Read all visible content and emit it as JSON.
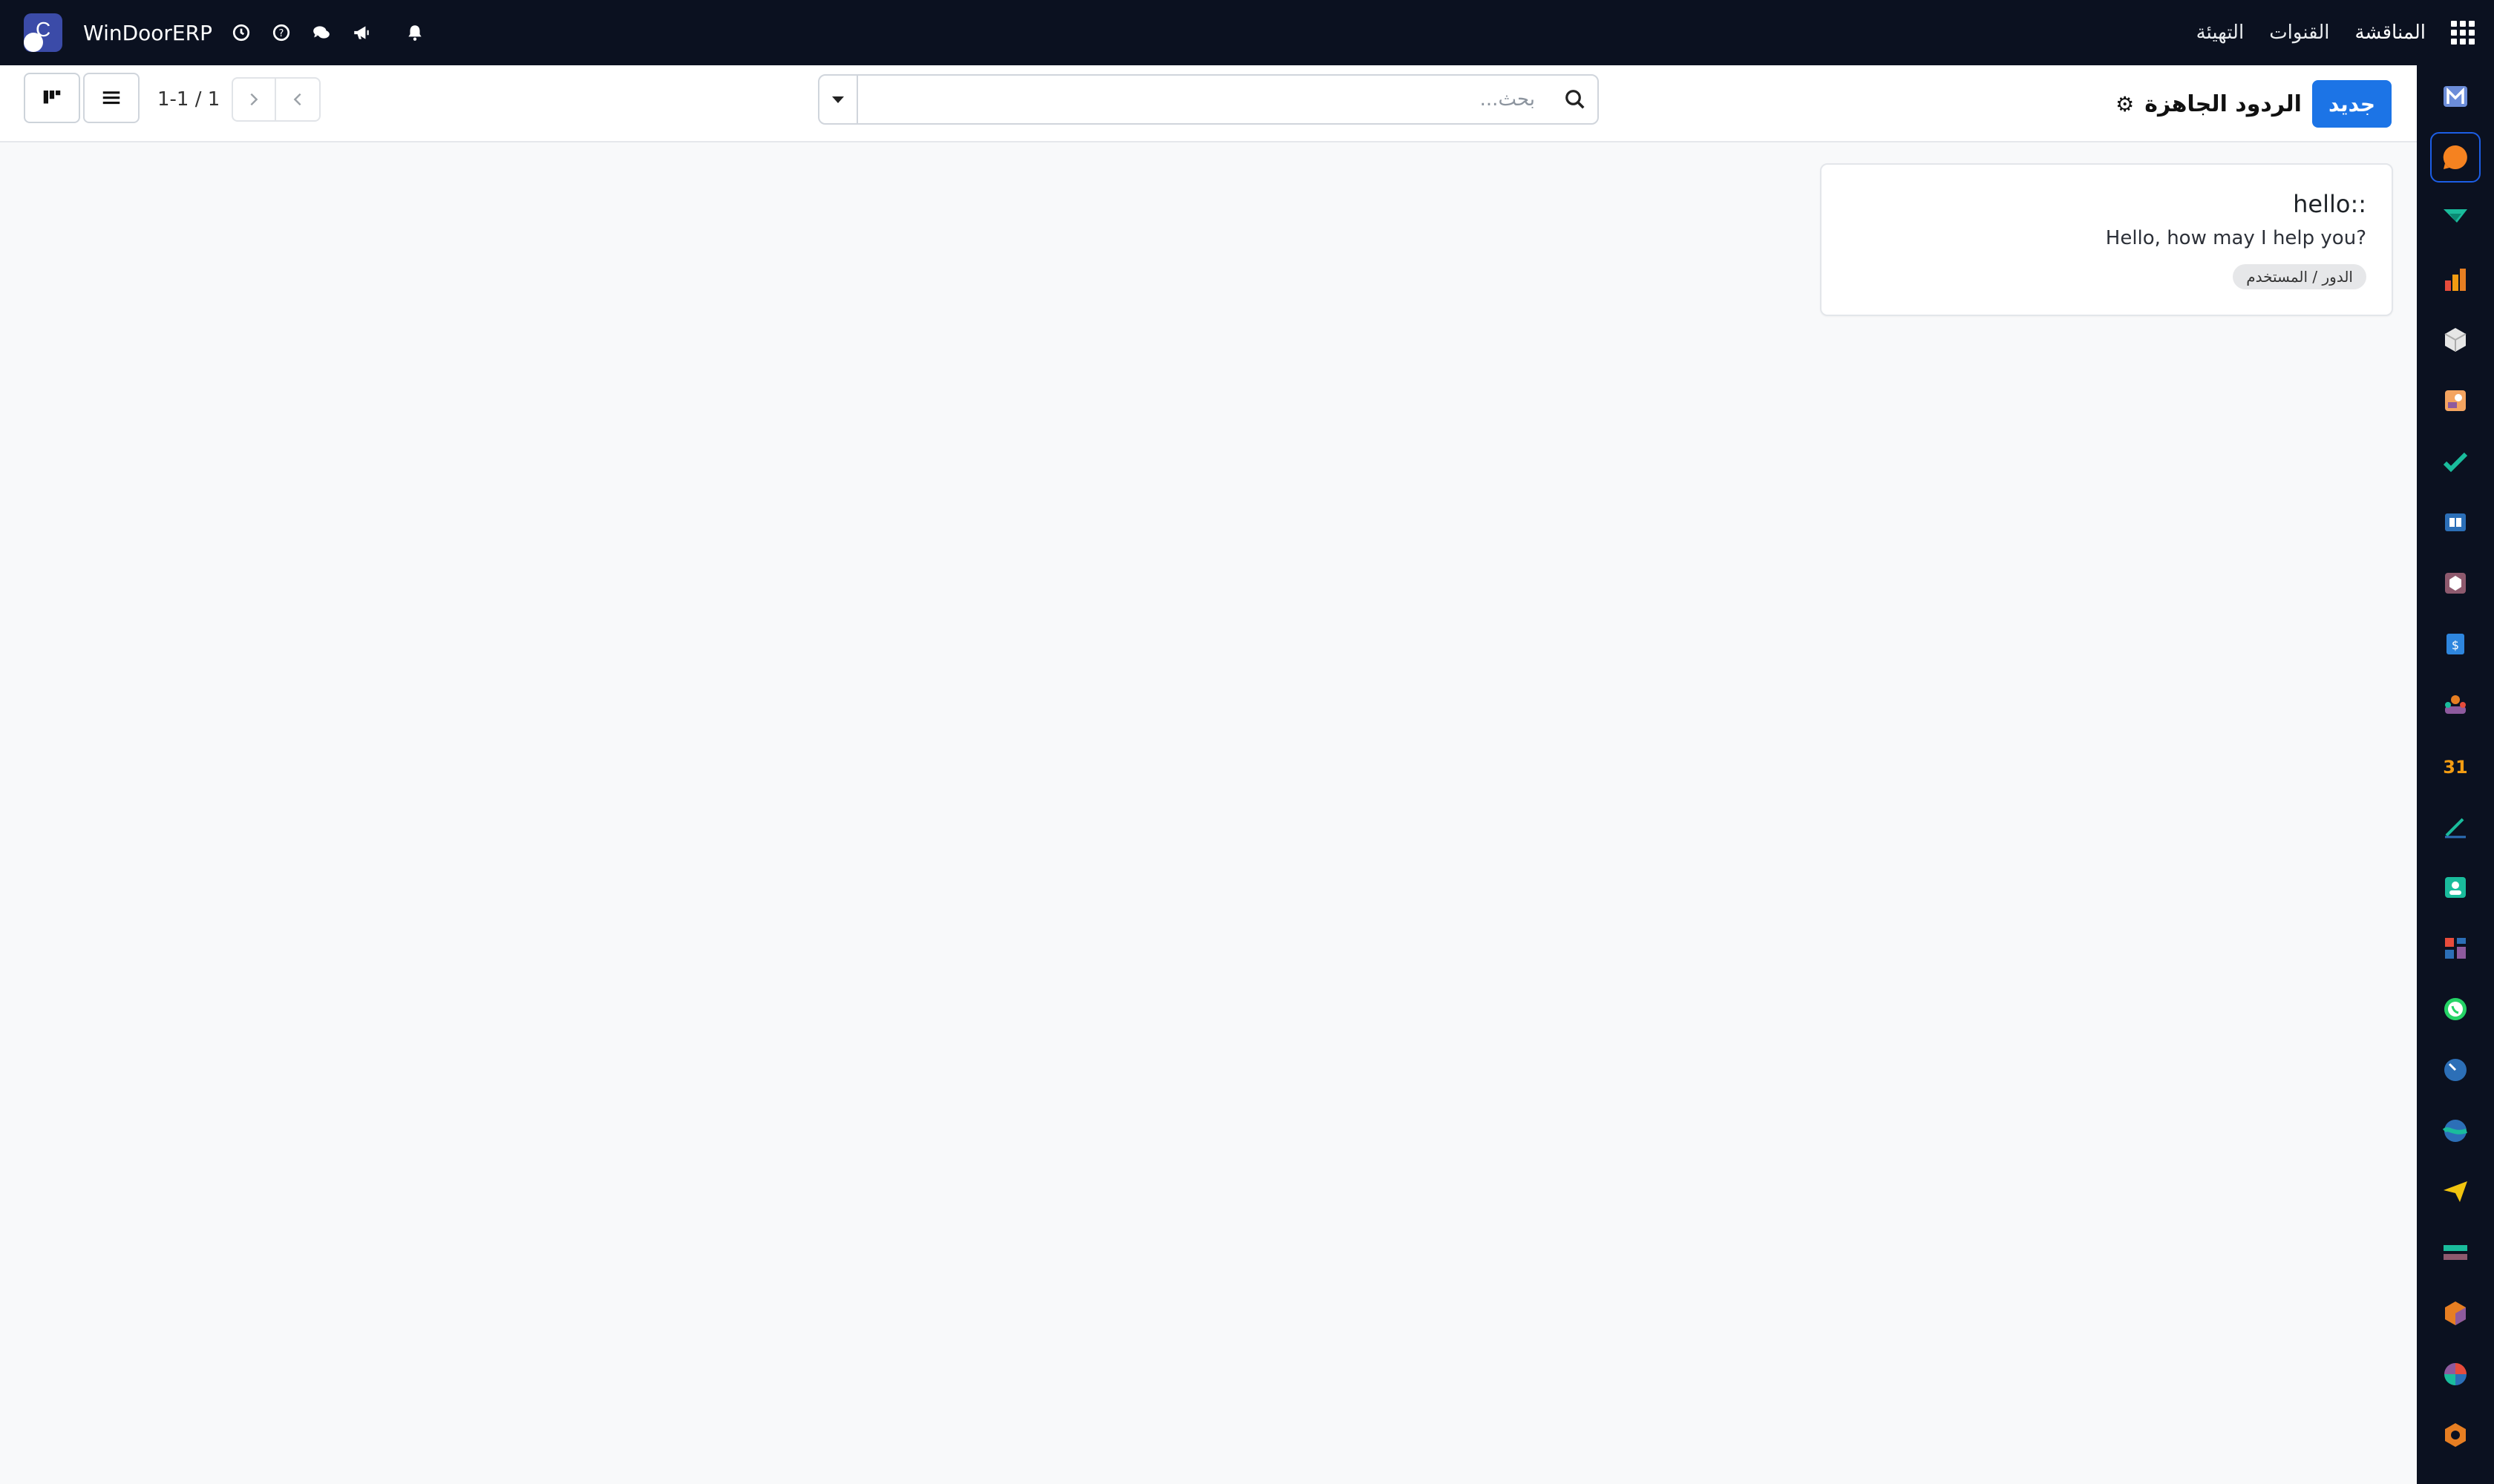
{
  "topbar": {
    "brand": "المناقشة",
    "menu": [
      "المناقشة",
      "القنوات",
      "التهيئة"
    ],
    "company_name": "WinDoorERP",
    "icons": [
      "apps-grid-icon",
      "bell-icon",
      "bullhorn-icon",
      "chat-icon",
      "help-icon",
      "clock-icon"
    ]
  },
  "control_panel": {
    "new_button": "جديد",
    "title": "الردود الجاهزة",
    "settings_icon": "gear-icon",
    "search_placeholder": "بحث...",
    "pager_value": "1-1 / 1"
  },
  "card": {
    "shortcut": "hello::",
    "text": "Hello, how may I help you?",
    "tag": "الدور / المستخدم"
  },
  "dock": {
    "apps": [
      "mail-app-icon",
      "discuss-app-icon",
      "filter-app-icon",
      "sales-app-icon",
      "inventory-app-icon",
      "employees-app-icon",
      "project-app-icon",
      "knowledge-app-icon",
      "product-app-icon",
      "invoice-app-icon",
      "crm-app-icon",
      "calendar-app-icon",
      "sign-app-icon",
      "contacts-app-icon",
      "dashboard-app-icon",
      "whatsapp-app-icon",
      "timeoff-app-icon",
      "website-app-icon",
      "email-marketing-app-icon",
      "accounting-app-icon",
      "manufacturing-app-icon",
      "reporting-app-icon",
      "settings-app-icon"
    ],
    "active_index": 1
  }
}
